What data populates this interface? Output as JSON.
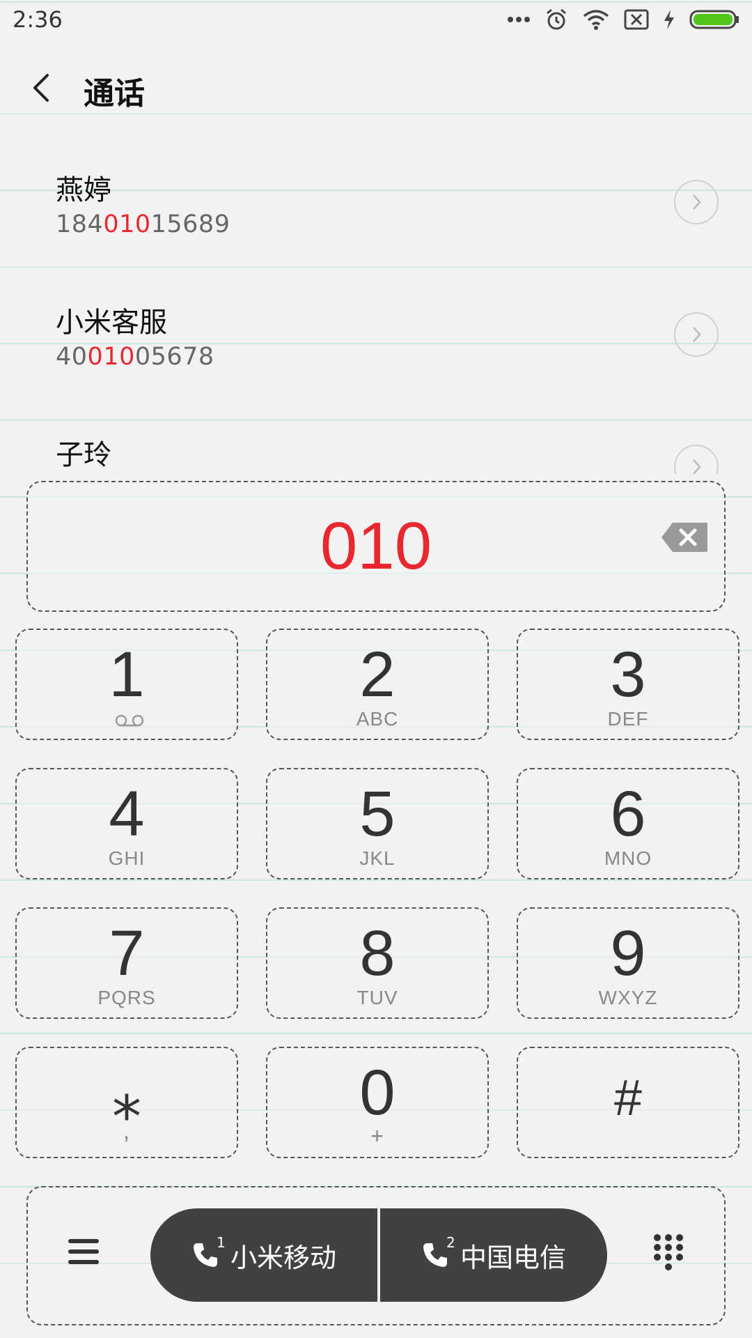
{
  "status_bar": {
    "time": "2:36",
    "icons": [
      "more-dots-icon",
      "alarm-icon",
      "wifi-icon",
      "no-sim-icon",
      "charging-bolt-icon",
      "battery-icon"
    ],
    "battery_color": "#52c41a"
  },
  "header": {
    "back_icon": "chevron-left-icon",
    "title": "通话"
  },
  "contacts": [
    {
      "name": "燕婷",
      "number_prefix": "184",
      "number_match": "010",
      "number_suffix": "15689"
    },
    {
      "name": "小米客服",
      "number_prefix": "40",
      "number_match": "010",
      "number_suffix": "05678"
    },
    {
      "name": "子玲",
      "number_prefix": "",
      "number_match": "",
      "number_suffix": ""
    }
  ],
  "dialer": {
    "input": "010",
    "backspace_icon": "backspace-icon",
    "keys": [
      {
        "digit": "1",
        "letters": ""
      },
      {
        "digit": "2",
        "letters": "ABC"
      },
      {
        "digit": "3",
        "letters": "DEF"
      },
      {
        "digit": "4",
        "letters": "GHI"
      },
      {
        "digit": "5",
        "letters": "JKL"
      },
      {
        "digit": "6",
        "letters": "MNO"
      },
      {
        "digit": "7",
        "letters": "PQRS"
      },
      {
        "digit": "8",
        "letters": "TUV"
      },
      {
        "digit": "9",
        "letters": "WXYZ"
      },
      {
        "digit": "⁎",
        "letters": ","
      },
      {
        "digit": "0",
        "letters": "+"
      },
      {
        "digit": "#",
        "letters": ""
      }
    ]
  },
  "bottom_bar": {
    "menu_icon": "menu-icon",
    "sim1": {
      "index": "1",
      "label": "小米移动"
    },
    "sim2": {
      "index": "2",
      "label": "中国电信"
    },
    "keypad_icon": "dialpad-icon"
  },
  "colors": {
    "accent": "#e8282e",
    "call_button": "#414141",
    "paper_line": "#cfe6df"
  }
}
